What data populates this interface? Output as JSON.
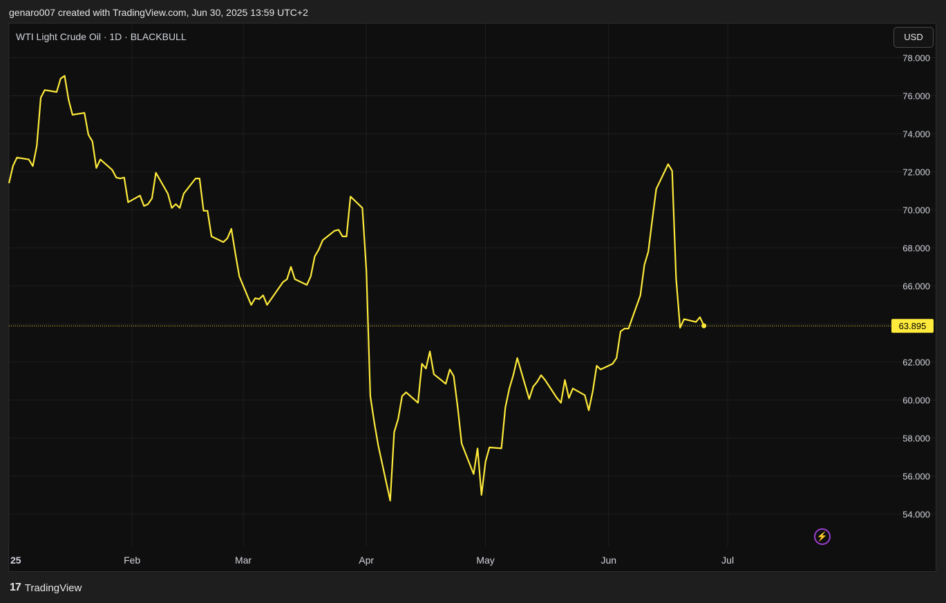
{
  "header": {
    "attribution": "genaro007 created with TradingView.com, Jun 30, 2025 13:59 UTC+2"
  },
  "symbol_label": "WTI Light Crude Oil · 1D · BLACKBULL",
  "currency_button": "USD",
  "footer": {
    "brand": "TradingView",
    "logo_mark": "17"
  },
  "colors": {
    "line": "#ffeb3b",
    "background": "#0f0f0f",
    "grid": "#1f1f1f",
    "text": "#d1d4dc",
    "price_tag": "#ffeb3b",
    "bolt": "#b04ee8"
  },
  "icons": {
    "bolt": "lightning-icon",
    "logo": "tradingview-logo-icon"
  },
  "chart_data": {
    "type": "line",
    "title": "",
    "xlabel": "",
    "ylabel": "",
    "ylim": [
      52.3,
      79.8
    ],
    "y_ticks": [
      "78.000",
      "76.000",
      "74.000",
      "72.000",
      "70.000",
      "68.000",
      "66.000",
      "64.000",
      "62.000",
      "60.000",
      "58.000",
      "56.000",
      "54.000"
    ],
    "x_ticks": [
      {
        "label": "25",
        "date": "2025-01-01"
      },
      {
        "label": "Feb",
        "date": "2025-02-01"
      },
      {
        "label": "Mar",
        "date": "2025-03-01"
      },
      {
        "label": "Apr",
        "date": "2025-04-01"
      },
      {
        "label": "May",
        "date": "2025-05-01"
      },
      {
        "label": "Jun",
        "date": "2025-06-01"
      },
      {
        "label": "Jul",
        "date": "2025-07-01"
      }
    ],
    "x_range": [
      "2025-01-01",
      "2025-08-10"
    ],
    "last_price": "63.895",
    "last_value": 63.895,
    "grid": true,
    "series": [
      {
        "values": [
          [
            "2025-01-01",
            71.4
          ],
          [
            "2025-01-02",
            72.3
          ],
          [
            "2025-01-03",
            72.75
          ],
          [
            "2025-01-06",
            72.65
          ],
          [
            "2025-01-07",
            72.3
          ],
          [
            "2025-01-08",
            73.35
          ],
          [
            "2025-01-09",
            75.9
          ],
          [
            "2025-01-10",
            76.3
          ],
          [
            "2025-01-13",
            76.2
          ],
          [
            "2025-01-14",
            76.9
          ],
          [
            "2025-01-15",
            77.05
          ],
          [
            "2025-01-16",
            75.8
          ],
          [
            "2025-01-17",
            75.0
          ],
          [
            "2025-01-20",
            75.1
          ],
          [
            "2025-01-21",
            73.95
          ],
          [
            "2025-01-22",
            73.6
          ],
          [
            "2025-01-23",
            72.2
          ],
          [
            "2025-01-24",
            72.65
          ],
          [
            "2025-01-27",
            72.1
          ],
          [
            "2025-01-28",
            71.7
          ],
          [
            "2025-01-29",
            71.65
          ],
          [
            "2025-01-30",
            71.7
          ],
          [
            "2025-01-31",
            70.4
          ],
          [
            "2025-02-03",
            70.75
          ],
          [
            "2025-02-04",
            70.2
          ],
          [
            "2025-02-05",
            70.3
          ],
          [
            "2025-02-06",
            70.6
          ],
          [
            "2025-02-07",
            71.95
          ],
          [
            "2025-02-10",
            70.85
          ],
          [
            "2025-02-11",
            70.1
          ],
          [
            "2025-02-12",
            70.3
          ],
          [
            "2025-02-13",
            70.1
          ],
          [
            "2025-02-14",
            70.85
          ],
          [
            "2025-02-17",
            71.65
          ],
          [
            "2025-02-18",
            71.65
          ],
          [
            "2025-02-19",
            69.95
          ],
          [
            "2025-02-20",
            69.95
          ],
          [
            "2025-02-21",
            68.6
          ],
          [
            "2025-02-24",
            68.3
          ],
          [
            "2025-02-25",
            68.5
          ],
          [
            "2025-02-26",
            69.0
          ],
          [
            "2025-02-27",
            67.7
          ],
          [
            "2025-02-28",
            66.5
          ],
          [
            "2025-03-03",
            65.0
          ],
          [
            "2025-03-04",
            65.35
          ],
          [
            "2025-03-05",
            65.3
          ],
          [
            "2025-03-06",
            65.5
          ],
          [
            "2025-03-07",
            65.0
          ],
          [
            "2025-03-10",
            65.9
          ],
          [
            "2025-03-11",
            66.2
          ],
          [
            "2025-03-12",
            66.35
          ],
          [
            "2025-03-13",
            67.0
          ],
          [
            "2025-03-14",
            66.35
          ],
          [
            "2025-03-17",
            66.05
          ],
          [
            "2025-03-18",
            66.5
          ],
          [
            "2025-03-19",
            67.55
          ],
          [
            "2025-03-20",
            67.9
          ],
          [
            "2025-03-21",
            68.4
          ],
          [
            "2025-03-24",
            68.9
          ],
          [
            "2025-03-25",
            68.95
          ],
          [
            "2025-03-26",
            68.6
          ],
          [
            "2025-03-27",
            68.6
          ],
          [
            "2025-03-28",
            70.7
          ],
          [
            "2025-03-31",
            70.1
          ],
          [
            "2025-04-01",
            66.8
          ],
          [
            "2025-04-02",
            60.2
          ],
          [
            "2025-04-03",
            58.8
          ],
          [
            "2025-04-04",
            57.6
          ],
          [
            "2025-04-07",
            54.7
          ],
          [
            "2025-04-08",
            58.3
          ],
          [
            "2025-04-09",
            59.0
          ],
          [
            "2025-04-10",
            60.2
          ],
          [
            "2025-04-11",
            60.4
          ],
          [
            "2025-04-14",
            59.85
          ],
          [
            "2025-04-15",
            61.9
          ],
          [
            "2025-04-16",
            61.65
          ],
          [
            "2025-04-17",
            62.55
          ],
          [
            "2025-04-18",
            61.35
          ],
          [
            "2025-04-21",
            60.85
          ],
          [
            "2025-04-22",
            61.6
          ],
          [
            "2025-04-23",
            61.25
          ],
          [
            "2025-04-24",
            59.6
          ],
          [
            "2025-04-25",
            57.7
          ],
          [
            "2025-04-28",
            56.1
          ],
          [
            "2025-04-29",
            57.45
          ],
          [
            "2025-04-30",
            55.0
          ],
          [
            "2025-05-01",
            56.75
          ],
          [
            "2025-05-02",
            57.5
          ],
          [
            "2025-05-05",
            57.45
          ],
          [
            "2025-05-06",
            59.6
          ],
          [
            "2025-05-07",
            60.6
          ],
          [
            "2025-05-08",
            61.3
          ],
          [
            "2025-05-09",
            62.2
          ],
          [
            "2025-05-12",
            60.05
          ],
          [
            "2025-05-13",
            60.7
          ],
          [
            "2025-05-14",
            60.95
          ],
          [
            "2025-05-15",
            61.3
          ],
          [
            "2025-05-16",
            61.05
          ],
          [
            "2025-05-19",
            60.1
          ],
          [
            "2025-05-20",
            59.85
          ],
          [
            "2025-05-21",
            61.05
          ],
          [
            "2025-05-22",
            60.1
          ],
          [
            "2025-05-23",
            60.6
          ],
          [
            "2025-05-26",
            60.25
          ],
          [
            "2025-05-27",
            59.45
          ],
          [
            "2025-05-28",
            60.45
          ],
          [
            "2025-05-29",
            61.8
          ],
          [
            "2025-05-30",
            61.6
          ],
          [
            "2025-06-02",
            61.9
          ],
          [
            "2025-06-03",
            62.2
          ],
          [
            "2025-06-04",
            63.6
          ],
          [
            "2025-06-05",
            63.75
          ],
          [
            "2025-06-06",
            63.75
          ],
          [
            "2025-06-09",
            65.5
          ],
          [
            "2025-06-10",
            67.1
          ],
          [
            "2025-06-11",
            67.8
          ],
          [
            "2025-06-12",
            69.5
          ],
          [
            "2025-06-13",
            71.1
          ],
          [
            "2025-06-16",
            72.4
          ],
          [
            "2025-06-17",
            72.05
          ],
          [
            "2025-06-18",
            66.4
          ],
          [
            "2025-06-19",
            63.8
          ],
          [
            "2025-06-20",
            64.25
          ],
          [
            "2025-06-23",
            64.1
          ],
          [
            "2025-06-24",
            64.35
          ],
          [
            "2025-06-25",
            63.9
          ]
        ]
      }
    ]
  }
}
